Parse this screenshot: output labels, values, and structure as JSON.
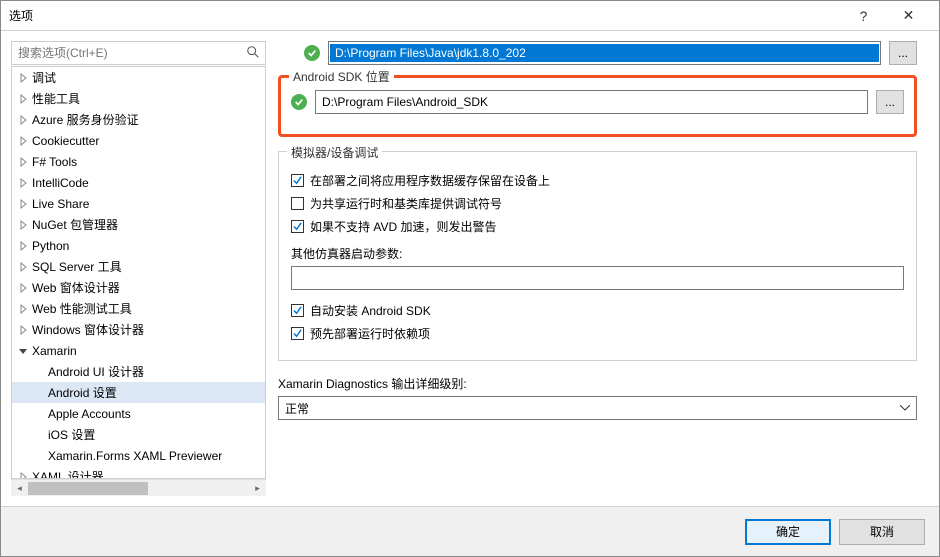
{
  "window": {
    "title": "选项"
  },
  "sidebar": {
    "search_placeholder": "搜索选项(Ctrl+E)",
    "items": [
      {
        "label": "调试",
        "depth": 0,
        "expanded": false
      },
      {
        "label": "性能工具",
        "depth": 0,
        "expanded": false
      },
      {
        "label": "Azure 服务身份验证",
        "depth": 0,
        "expanded": false
      },
      {
        "label": "Cookiecutter",
        "depth": 0,
        "expanded": false
      },
      {
        "label": "F# Tools",
        "depth": 0,
        "expanded": false
      },
      {
        "label": "IntelliCode",
        "depth": 0,
        "expanded": false
      },
      {
        "label": "Live Share",
        "depth": 0,
        "expanded": false
      },
      {
        "label": "NuGet 包管理器",
        "depth": 0,
        "expanded": false
      },
      {
        "label": "Python",
        "depth": 0,
        "expanded": false
      },
      {
        "label": "SQL Server 工具",
        "depth": 0,
        "expanded": false
      },
      {
        "label": "Web 窗体设计器",
        "depth": 0,
        "expanded": false
      },
      {
        "label": "Web 性能测试工具",
        "depth": 0,
        "expanded": false
      },
      {
        "label": "Windows 窗体设计器",
        "depth": 0,
        "expanded": false
      },
      {
        "label": "Xamarin",
        "depth": 0,
        "expanded": true
      },
      {
        "label": "Android UI 设计器",
        "depth": 1
      },
      {
        "label": "Android 设置",
        "depth": 1,
        "selected": true
      },
      {
        "label": "Apple Accounts",
        "depth": 1
      },
      {
        "label": "iOS 设置",
        "depth": 1
      },
      {
        "label": "Xamarin.Forms XAML Previewer",
        "depth": 1
      },
      {
        "label": "XAML 设计器",
        "depth": 0,
        "expanded": false
      }
    ]
  },
  "jdk": {
    "value": "D:\\Program Files\\Java\\jdk1.8.0_202",
    "browse": "..."
  },
  "sdk": {
    "group_label": "Android SDK 位置",
    "value": "D:\\Program Files\\Android_SDK",
    "browse": "..."
  },
  "debug": {
    "group_label": "模拟器/设备调试",
    "chk1": "在部署之间将应用程序数据缓存保留在设备上",
    "chk2": "为共享运行时和基类库提供调试符号",
    "chk3": "如果不支持 AVD 加速，则发出警告",
    "params_label": "其他仿真器启动参数:",
    "params_value": "",
    "chk4": "自动安装 Android SDK",
    "chk5": "预先部署运行时依赖项"
  },
  "diag": {
    "label": "Xamarin Diagnostics 输出详细级别:",
    "value": "正常"
  },
  "footer": {
    "ok": "确定",
    "cancel": "取消"
  },
  "colors": {
    "highlight": "#f25022",
    "accent": "#0078d4",
    "ok_green": "#4caf50"
  }
}
